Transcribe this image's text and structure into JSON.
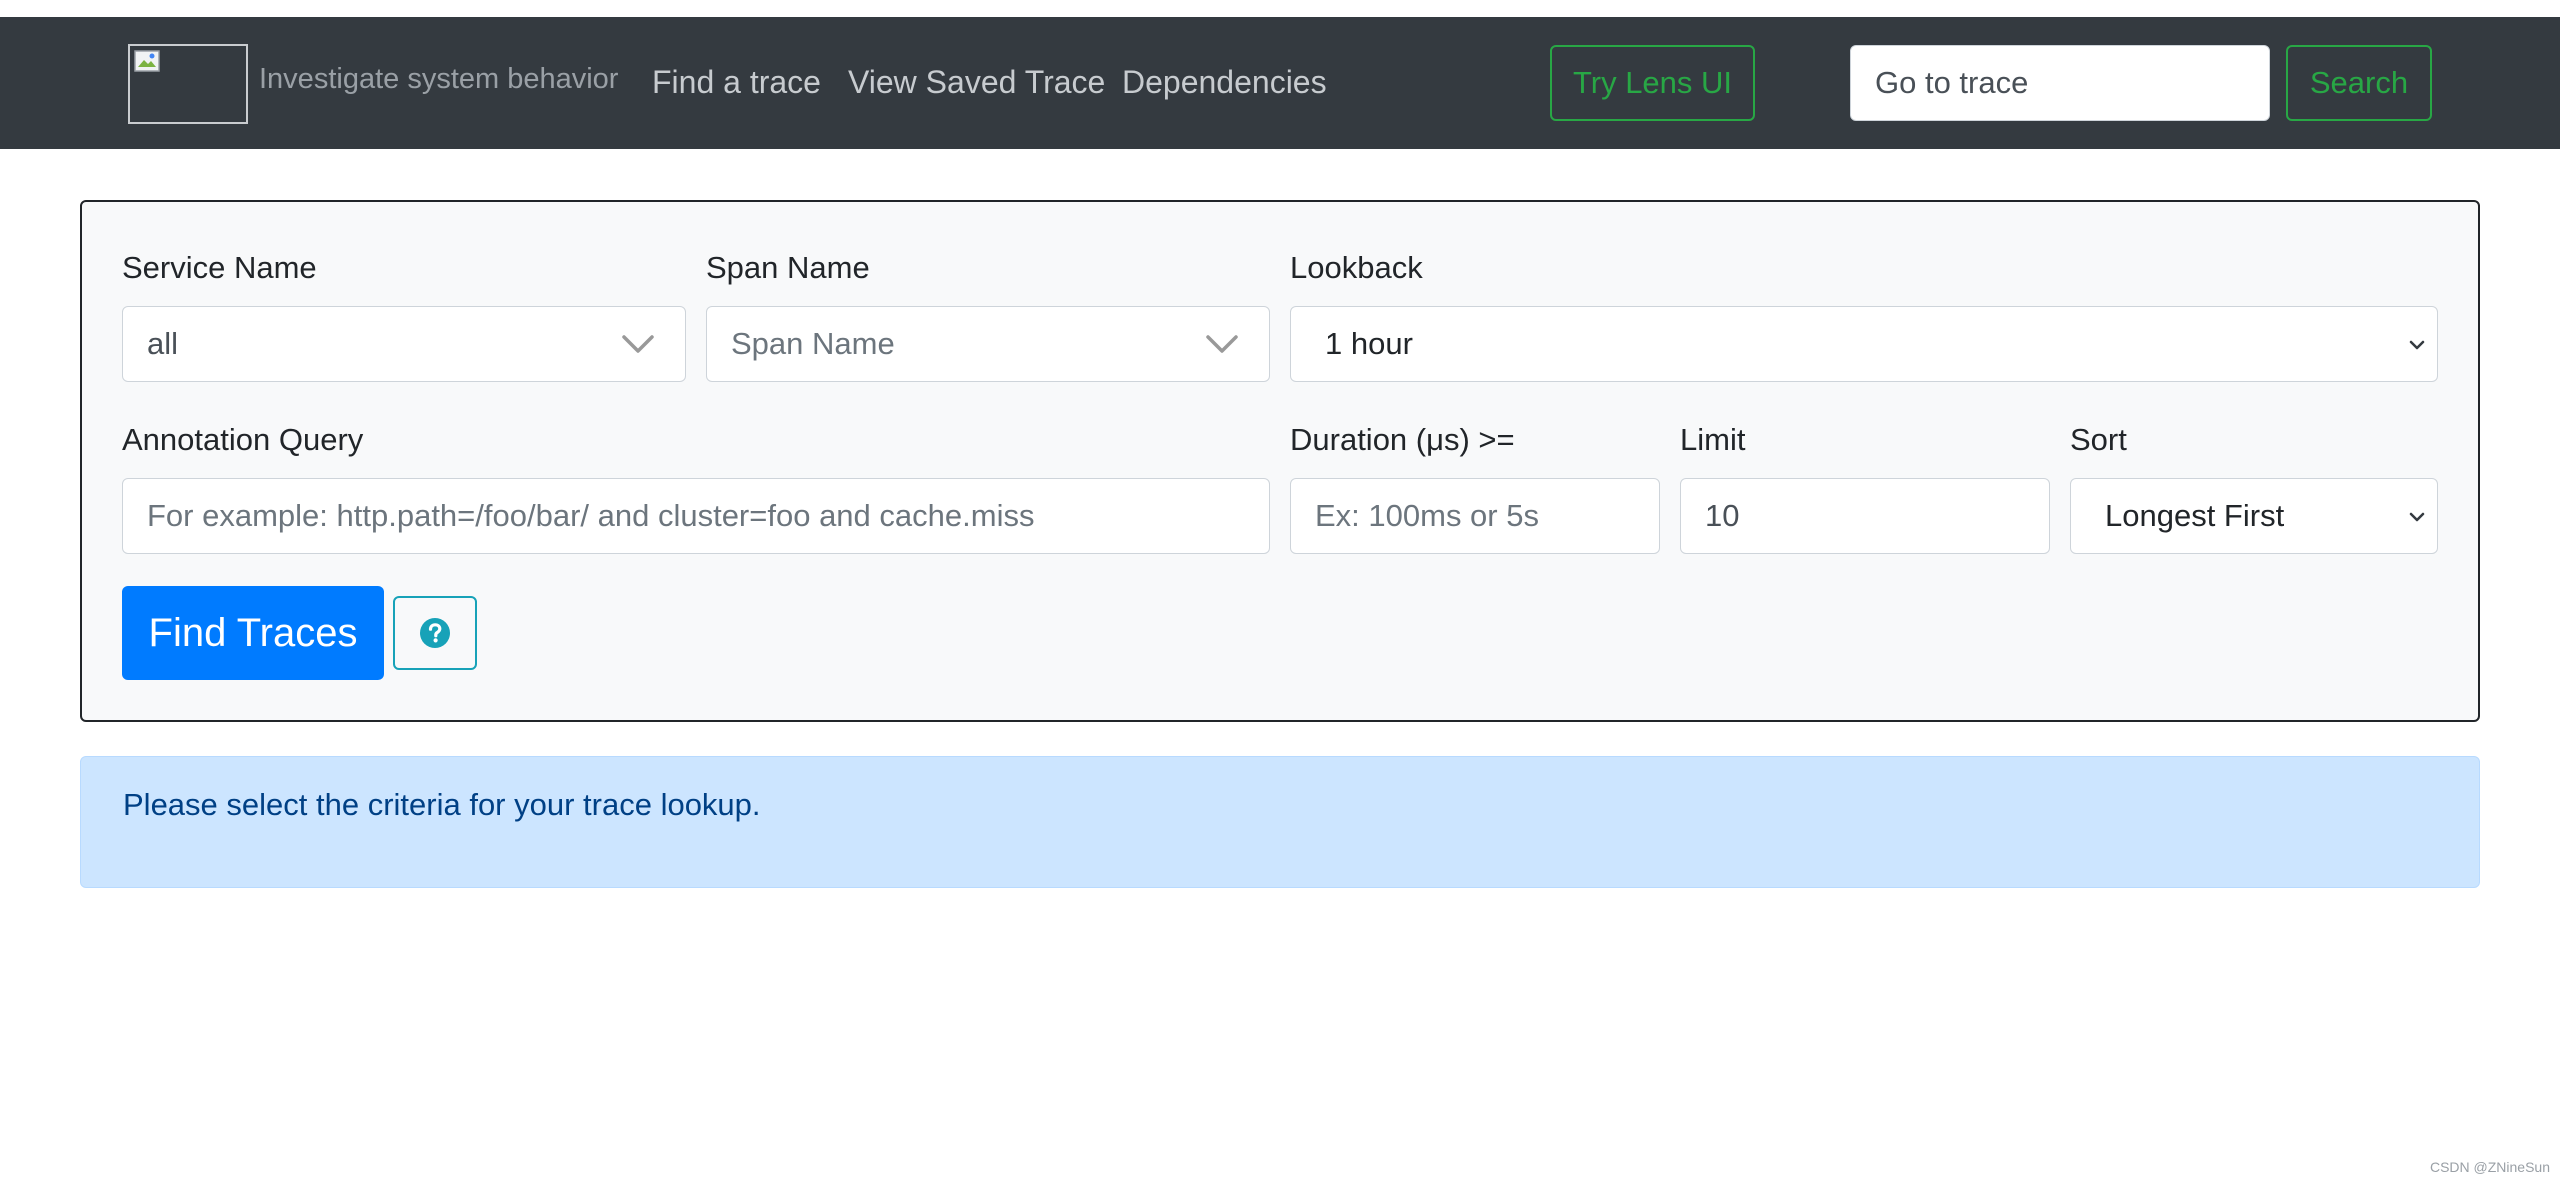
{
  "navbar": {
    "brand_tagline": "Investigate system behavior",
    "links": [
      "Find a trace",
      "View Saved Trace",
      "Dependencies"
    ],
    "lens_button": "Try Lens UI",
    "trace_input_placeholder": "Go to trace",
    "search_button": "Search"
  },
  "form": {
    "service_name": {
      "label": "Service Name",
      "value": "all"
    },
    "span_name": {
      "label": "Span Name",
      "placeholder": "Span Name"
    },
    "lookback": {
      "label": "Lookback",
      "value": "1 hour"
    },
    "annotation_query": {
      "label": "Annotation Query",
      "placeholder": "For example: http.path=/foo/bar/ and cluster=foo and cache.miss"
    },
    "duration": {
      "label": "Duration (μs) >=",
      "placeholder": "Ex: 100ms or 5s"
    },
    "limit": {
      "label": "Limit",
      "value": "10"
    },
    "sort": {
      "label": "Sort",
      "value": "Longest First"
    },
    "find_button": "Find Traces",
    "help_icon": "question-circle-icon"
  },
  "alert": {
    "message": "Please select the criteria for your trace lookup."
  },
  "watermark": "CSDN @ZNineSun",
  "colors": {
    "navbar_bg": "#343a40",
    "success": "#28a745",
    "primary": "#007bff",
    "info": "#17a2b8",
    "alert_bg": "#cce5ff",
    "alert_text": "#004085"
  }
}
